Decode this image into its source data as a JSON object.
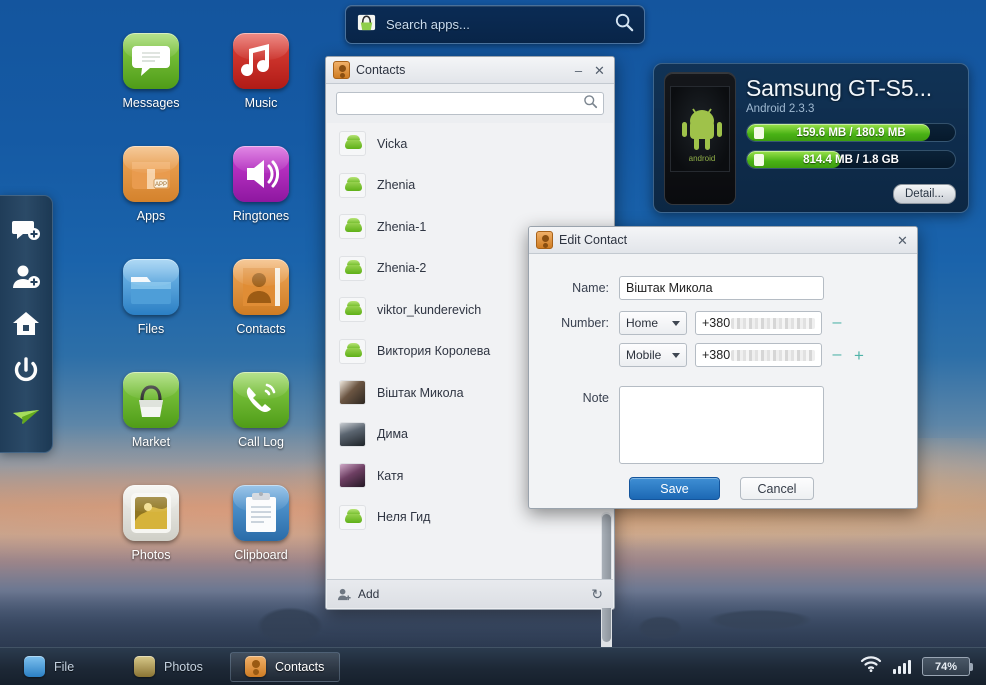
{
  "search": {
    "placeholder": "Search apps..."
  },
  "device": {
    "name": "Samsung GT-S5...",
    "os": "Android 2.3.3",
    "internal_memory": "159.6 MB / 180.9 MB",
    "internal_memory_percent": 88,
    "sd_memory": "814.4 MB / 1.8 GB",
    "sd_memory_percent": 45,
    "detail_label": "Detail..."
  },
  "desktop_apps": [
    {
      "label": "Messages",
      "icon": "message-bubble-icon"
    },
    {
      "label": "Music",
      "icon": "music-note-icon"
    },
    {
      "label": "Apps",
      "icon": "package-box-icon"
    },
    {
      "label": "Ringtones",
      "icon": "speaker-icon"
    },
    {
      "label": "Files",
      "icon": "folder-icon"
    },
    {
      "label": "Contacts",
      "icon": "person-card-icon"
    },
    {
      "label": "Market",
      "icon": "shopping-bag-icon"
    },
    {
      "label": "Call Log",
      "icon": "phone-handset-icon"
    },
    {
      "label": "Photos",
      "icon": "picture-icon"
    },
    {
      "label": "Clipboard",
      "icon": "clipboard-icon"
    }
  ],
  "dock": [
    {
      "icon": "new-message-icon"
    },
    {
      "icon": "add-contact-icon"
    },
    {
      "icon": "home-icon"
    },
    {
      "icon": "power-icon"
    },
    {
      "icon": "send-paper-plane-icon"
    }
  ],
  "contacts_window": {
    "title": "Contacts",
    "minimize_label": "–",
    "close_label": "✕",
    "search_value": "",
    "search_placeholder": "",
    "add_label": "Add",
    "refresh_label": "↻",
    "contacts": [
      {
        "name": "Vicka",
        "avatar": "android-default"
      },
      {
        "name": "Zhenia",
        "avatar": "android-default"
      },
      {
        "name": "Zhenia-1",
        "avatar": "android-default"
      },
      {
        "name": "Zhenia-2",
        "avatar": "android-default"
      },
      {
        "name": "viktor_kunderevich",
        "avatar": "android-default"
      },
      {
        "name": "Виктория Королева",
        "avatar": "android-default"
      },
      {
        "name": "Віштак Микола",
        "avatar": "photo-1"
      },
      {
        "name": "Дима",
        "avatar": "photo-2"
      },
      {
        "name": "Катя",
        "avatar": "photo-3"
      },
      {
        "name": "Неля Гид",
        "avatar": "android-default"
      }
    ]
  },
  "edit_contact": {
    "title": "Edit Contact",
    "close_label": "✕",
    "name_label": "Name:",
    "name_value": "Віштак Микола",
    "number_label": "Number:",
    "numbers": [
      {
        "type": "Home",
        "prefix": "+380",
        "remove_label": "–",
        "add_label": ""
      },
      {
        "type": "Mobile",
        "prefix": "+380",
        "remove_label": "–",
        "add_label": "+"
      }
    ],
    "note_label": "Note",
    "note_value": "",
    "save_label": "Save",
    "cancel_label": "Cancel"
  },
  "taskbar": {
    "items": [
      {
        "label": "File",
        "icon": "folder-icon",
        "active": false
      },
      {
        "label": "Photos",
        "icon": "picture-icon",
        "active": false
      },
      {
        "label": "Contacts",
        "icon": "person-card-icon",
        "active": true
      }
    ],
    "battery": "74%",
    "wifi_icon": "wifi-icon",
    "signal_icon": "signal-bars-icon"
  },
  "colors": {
    "accent_blue": "#1c68b4",
    "desktop_blue": "#14559e",
    "meter_green": "#49b215"
  }
}
